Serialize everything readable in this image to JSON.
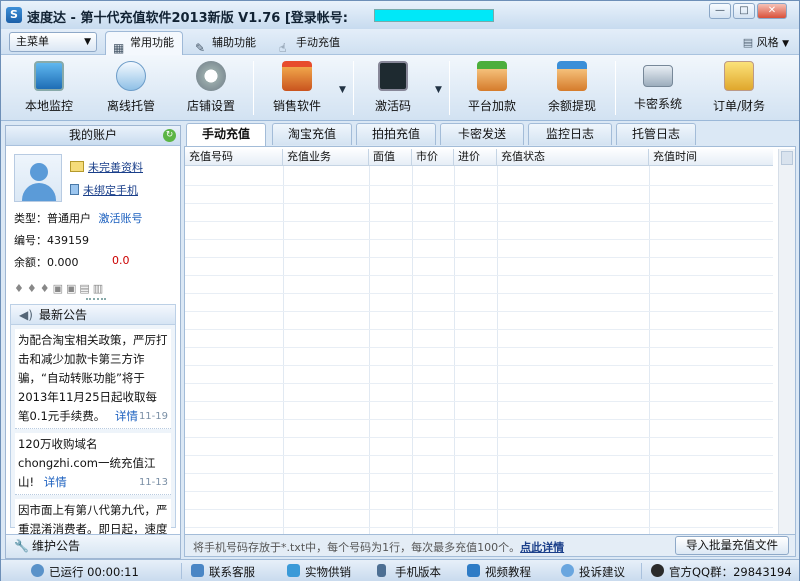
{
  "window": {
    "title": "速度达 - 第十代充值软件2013新版 V1.76  [登录帐号:",
    "account_hidden_color": "#00e8f8",
    "controls": [
      "—",
      "□",
      "✕"
    ]
  },
  "menubar": {
    "main_menu": "主菜单",
    "tabs": [
      "常用功能",
      "辅助功能",
      "手动充值"
    ],
    "skin": "风格"
  },
  "toolbar": {
    "items": [
      "本地监控",
      "离线托管",
      "店铺设置",
      "销售软件",
      "激活码",
      "平台加款",
      "余额提现",
      "卡密系统",
      "订单/财务"
    ]
  },
  "account": {
    "header": "我的账户",
    "link_profile": "未完善资料",
    "link_phone": "未绑定手机",
    "type_label": "类型：普通用户",
    "activate_link": "激活账号",
    "id_label": "编号：439159",
    "balance_label": "余额：0.000",
    "balance_red": "0.0",
    "badges": "♦♦♦▣▣▤▥"
  },
  "notices": {
    "header": "最新公告",
    "items": [
      {
        "text": "为配合淘宝相关政策，严厉打击和减少加款卡第三方诈骗，“自动转账功能”将于2013年11月25日起收取每笔0.1元手续费。",
        "more": "详情",
        "date": "11-19"
      },
      {
        "text": "120万收购域名chongzhi.com一统充值江山!",
        "more": "详情",
        "date": "11-13"
      },
      {
        "text": "因市面上有第八代第九代，严重混淆消费者。即日起，速度达所有更新为：第十代",
        "more": "",
        "date": ""
      }
    ],
    "maintenance": "维护公告"
  },
  "content": {
    "tabs": [
      "手动充值",
      "淘宝充值",
      "拍拍充值",
      "卡密发送",
      "监控日志",
      "托管日志"
    ],
    "columns": [
      "充值号码",
      "充值业务",
      "面值",
      "市价",
      "进价",
      "充值状态",
      "充值时间"
    ],
    "hint": "将手机号码存放于*.txt中，每个号码为1行，每次最多充值100个。",
    "hint_link": "点此详情",
    "import_button": "导入批量充值文件"
  },
  "status": {
    "items": [
      "已运行 00:00:11",
      "联系客服",
      "实物供销",
      "手机版本",
      "视频教程",
      "投诉建议",
      "官方QQ群：29843194"
    ]
  }
}
